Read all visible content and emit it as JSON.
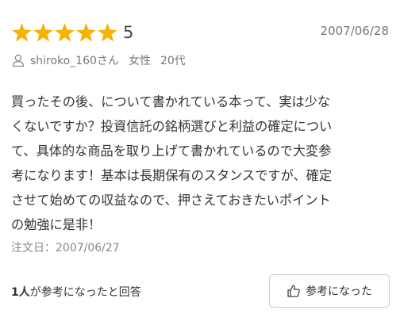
{
  "review": {
    "rating": {
      "stars": 5,
      "max_stars": 5,
      "score_text": "5",
      "star_color": "#f5b301"
    },
    "date": "2007/06/28",
    "reviewer": {
      "icon": "user-icon",
      "name": "shiroko_160さん",
      "gender": "女性",
      "age": "20代"
    },
    "body_lines": [
      "買ったその後、について書かれている本って、実は少な",
      "くないですか？投資信託の銘柄選びと利益の確定につい",
      "て、具体的な商品を取り上げて書かれているので大変参",
      "考になります！基本は長期保有のスタンスですが、確定",
      "させて始めての収益なので、押さえておきたいポイント",
      "の勉強に是非！"
    ],
    "order_date": {
      "label": "注文日：",
      "value": "2007/06/27"
    },
    "helpful": {
      "count": "1人",
      "suffix": "が参考になったと回答",
      "button_label": "参考になった",
      "button_icon": "thumbs-up-icon"
    }
  }
}
